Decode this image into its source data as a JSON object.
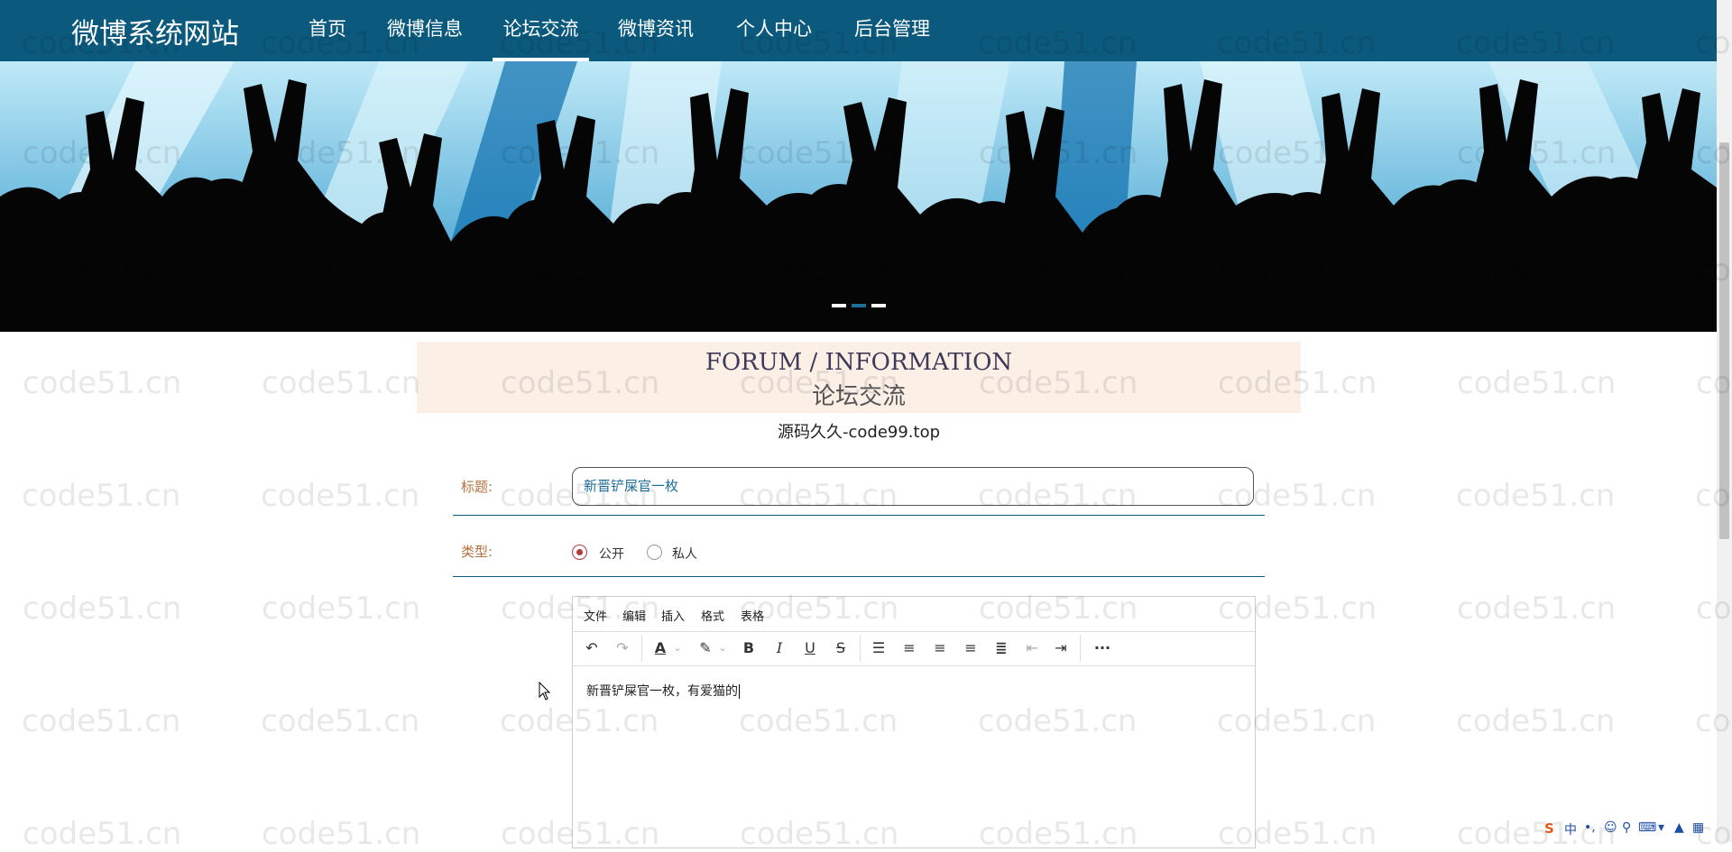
{
  "nav": {
    "brand": "微博系统网站",
    "items": [
      {
        "label": "首页"
      },
      {
        "label": "微博信息"
      },
      {
        "label": "论坛交流",
        "active": true
      },
      {
        "label": "微博资讯"
      },
      {
        "label": "个人中心"
      },
      {
        "label": "后台管理"
      }
    ],
    "color": "#0b5a7e"
  },
  "banner": {
    "slides": 3,
    "active_slide": 2
  },
  "section": {
    "title_en": "FORUM / INFORMATION",
    "title_cn": "论坛交流",
    "subtitle": "源码久久-code99.top"
  },
  "form": {
    "title_label": "标题:",
    "title_value": "新晋铲屎官一枚",
    "type_label": "类型:",
    "type_options": [
      {
        "label": "公开",
        "checked": true
      },
      {
        "label": "私人",
        "checked": false
      }
    ]
  },
  "editor": {
    "menu": [
      "文件",
      "编辑",
      "插入",
      "格式",
      "表格"
    ],
    "toolbar": [
      "undo-icon",
      "redo-icon",
      "font-color-icon",
      "highlight-icon",
      "bold-icon",
      "italic-icon",
      "underline-icon",
      "strikethrough-icon",
      "list-icon",
      "align-left-icon",
      "align-center-icon",
      "align-right-icon",
      "justify-icon",
      "outdent-icon",
      "indent-icon",
      "more-icon"
    ],
    "content": "新晋铲屎官一枚，有爱猫的"
  },
  "watermark": "code51.cn",
  "ime": {
    "mode": "中"
  }
}
